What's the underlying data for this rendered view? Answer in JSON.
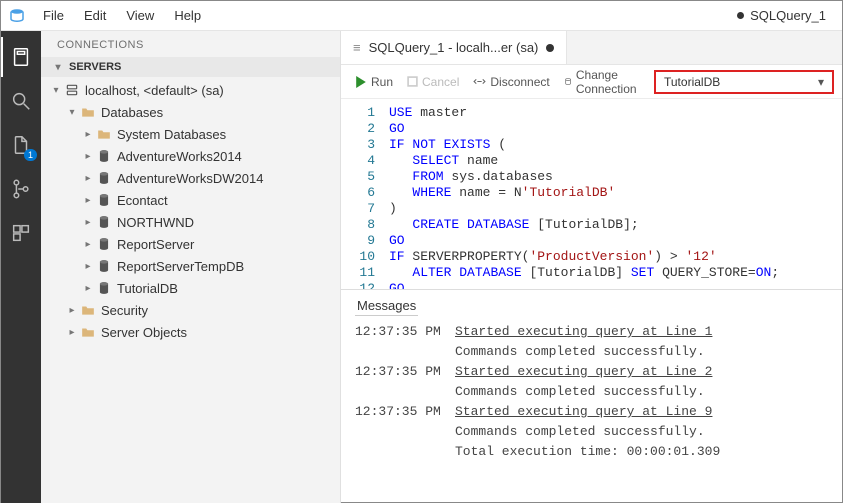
{
  "titlebar": {
    "menus": [
      "File",
      "Edit",
      "View",
      "Help"
    ],
    "dirty_file": "SQLQuery_1"
  },
  "sidepanel": {
    "title": "CONNECTIONS",
    "section": "SERVERS",
    "tree": {
      "server": "localhost, <default> (sa)",
      "databases_label": "Databases",
      "sysdb": "System Databases",
      "dbs": [
        "AdventureWorks2014",
        "AdventureWorksDW2014",
        "Econtact",
        "NORTHWND",
        "ReportServer",
        "ReportServerTempDB",
        "TutorialDB"
      ],
      "security": "Security",
      "server_objects": "Server Objects"
    }
  },
  "tab": {
    "label": "SQLQuery_1 - localh...er (sa)"
  },
  "toolbar": {
    "run": "Run",
    "cancel": "Cancel",
    "disconnect": "Disconnect",
    "change": "Change Connection",
    "db_selected": "TutorialDB"
  },
  "code_lines": [
    "USE master",
    "GO",
    "IF NOT EXISTS (",
    "   SELECT name",
    "   FROM sys.databases",
    "   WHERE name = N'TutorialDB'",
    ")",
    "   CREATE DATABASE [TutorialDB];",
    "GO",
    "IF SERVERPROPERTY('ProductVersion') > '12'",
    "   ALTER DATABASE [TutorialDB] SET QUERY_STORE=ON;",
    "GO"
  ],
  "messages": {
    "title": "Messages",
    "rows": [
      {
        "ts": "12:37:35 PM",
        "text": "Started executing query at Line 1",
        "u": true
      },
      {
        "ts": "",
        "text": "Commands completed successfully.",
        "u": false
      },
      {
        "ts": "12:37:35 PM",
        "text": "Started executing query at Line 2",
        "u": true
      },
      {
        "ts": "",
        "text": "Commands completed successfully.",
        "u": false
      },
      {
        "ts": "12:37:35 PM",
        "text": "Started executing query at Line 9",
        "u": true
      },
      {
        "ts": "",
        "text": "Commands completed successfully.",
        "u": false
      },
      {
        "ts": "",
        "text": "Total execution time: 00:00:01.309",
        "u": false
      }
    ]
  }
}
